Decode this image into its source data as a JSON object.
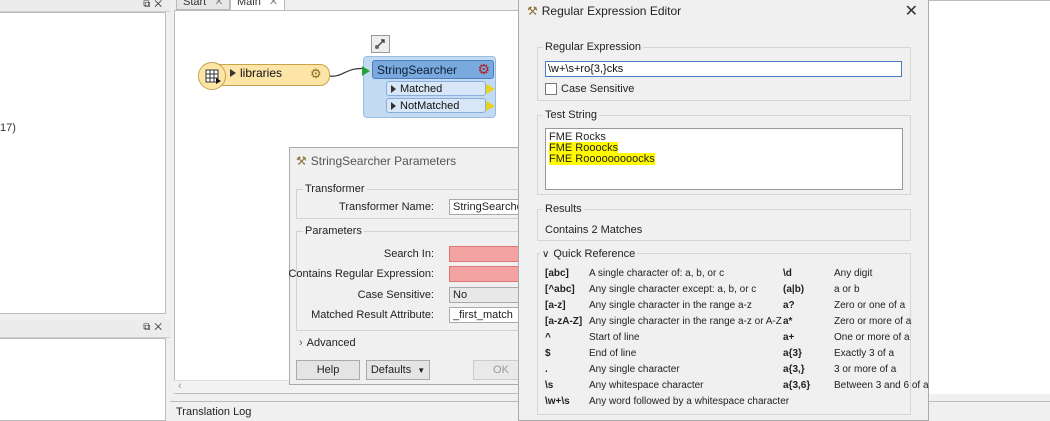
{
  "tabs": [
    {
      "label": "Start"
    },
    {
      "label": "Main"
    }
  ],
  "left_panel": {
    "partial_text": "17)"
  },
  "workspace": {
    "reader": {
      "name": "libraries"
    },
    "transformer": {
      "name": "StringSearcher",
      "ports": [
        "Matched",
        "NotMatched"
      ]
    }
  },
  "translation_log": {
    "label": "Translation Log"
  },
  "parameters_dialog": {
    "title": "StringSearcher Parameters",
    "transformer_section": "Transformer",
    "transformer_name_label": "Transformer Name:",
    "transformer_name_value": "StringSearcher",
    "parameters_section": "Parameters",
    "search_in_label": "Search In:",
    "regex_label": "Contains Regular Expression:",
    "case_label": "Case Sensitive:",
    "case_value": "No",
    "result_attr_label": "Matched Result Attribute:",
    "result_attr_value": "_first_match",
    "advanced_label": "Advanced",
    "help_button": "Help",
    "defaults_button": "Defaults",
    "ok_button": "OK"
  },
  "regex_editor": {
    "title": "Regular Expression Editor",
    "regex_section": "Regular Expression",
    "regex_value": "\\w+\\s+ro{3,}cks",
    "case_sensitive_label": "Case Sensitive",
    "test_section": "Test String",
    "test_lines": [
      {
        "text": "FME Rocks",
        "highlighted": false
      },
      {
        "text": "FME Rooocks",
        "highlighted": true
      },
      {
        "text": "FME Rooooooooocks",
        "highlighted": true
      }
    ],
    "results_section": "Results",
    "results_text": "Contains 2 Matches",
    "quick_ref_label": "Quick Reference",
    "quick_ref": [
      {
        "sym": "[abc]",
        "desc": "A single character of: a, b, or c",
        "sym2": "\\d",
        "desc2": "Any digit"
      },
      {
        "sym": "[^abc]",
        "desc": "Any single character except: a, b, or c",
        "sym2": "(a|b)",
        "desc2": "a or b"
      },
      {
        "sym": "[a-z]",
        "desc": "Any single character in the range a-z",
        "sym2": "a?",
        "desc2": "Zero or one of a"
      },
      {
        "sym": "[a-zA-Z]",
        "desc": "Any single character in the range a-z or A-Z",
        "sym2": "a*",
        "desc2": "Zero or more of a"
      },
      {
        "sym": "^",
        "desc": "Start of line",
        "sym2": "a+",
        "desc2": "One or more of a"
      },
      {
        "sym": "$",
        "desc": "End of line",
        "sym2": "a{3}",
        "desc2": "Exactly 3 of a"
      },
      {
        "sym": ".",
        "desc": "Any single character",
        "sym2": "a{3,}",
        "desc2": "3 or more of a"
      },
      {
        "sym": "\\s",
        "desc": "Any whitespace character",
        "sym2": "a{3,6}",
        "desc2": "Between 3 and 6 of a"
      },
      {
        "sym": "\\w+\\s",
        "desc": "Any word followed by a whitespace character",
        "sym2": "",
        "desc2": ""
      }
    ]
  }
}
